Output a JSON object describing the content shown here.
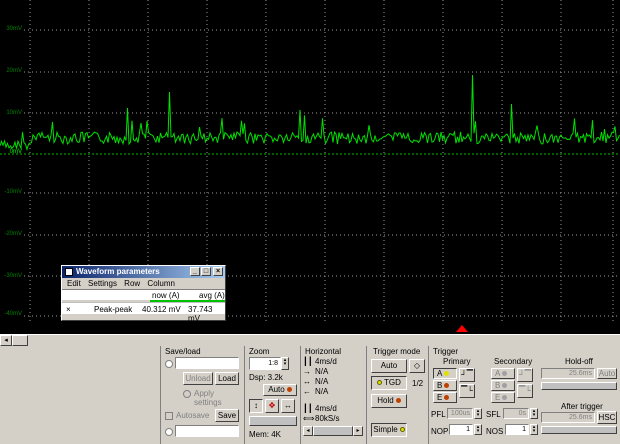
{
  "scope": {
    "y_labels": [
      "30mV",
      "20mV",
      "10mV",
      "0mV",
      "-10mV",
      "-20mV",
      "-30mV",
      "-40mV"
    ],
    "channel_marker": "1"
  },
  "waveform_window": {
    "title": "Waveform parameters",
    "menu": [
      "Edit",
      "Settings",
      "Row",
      "Column"
    ],
    "col_now": "now (A)",
    "col_avg": "avg (A)",
    "row_remove": "×",
    "row_name": "Peak-peak",
    "row_now": "40.312 mV",
    "row_avg": "37.743 mV",
    "btn_min": "_",
    "btn_max": "□",
    "btn_close": "×"
  },
  "saveload": {
    "title": "Save/load",
    "unload": "Unload",
    "load": "Load",
    "apply": "Apply settings",
    "autosave": "Autosave",
    "save": "Save"
  },
  "zoom": {
    "title": "Zoom",
    "ratio": "1:8",
    "dsp": "Dsp: 3.2k",
    "auto": "Auto",
    "mem": "Mem: 4K"
  },
  "horizontal": {
    "title": "Horizontal",
    "rows": [
      "4ms/d",
      "N/A",
      "N/A",
      "N/A"
    ],
    "rows2": [
      "4ms/d",
      "80kS/s"
    ]
  },
  "trigger_mode": {
    "title": "Trigger mode",
    "auto": "Auto",
    "tgd": "TGD",
    "half": "1/2",
    "hold": "Hold",
    "simple": "Simple"
  },
  "trigger": {
    "title": "Trigger",
    "primary": "Primary",
    "secondary": "Secondary",
    "holdoff": "Hold-off",
    "holdoff_value": "25.6ms",
    "holdoff_auto": "Auto",
    "a": "A",
    "b": "B",
    "e": "E",
    "pfl": "PFL",
    "pfl_value": "100us",
    "nop": "NOP",
    "nop_value": "1",
    "sfl": "SFL",
    "sfl_value": "0s",
    "nos": "NOS",
    "nos_value": "1",
    "after": "After trigger",
    "after_value": "25.6ms",
    "hsc": "HSC"
  },
  "colors": {
    "trace": "#00e000",
    "grid": "#9a9a9a",
    "zero_line": "#00c000",
    "marker": "#ff0000"
  }
}
